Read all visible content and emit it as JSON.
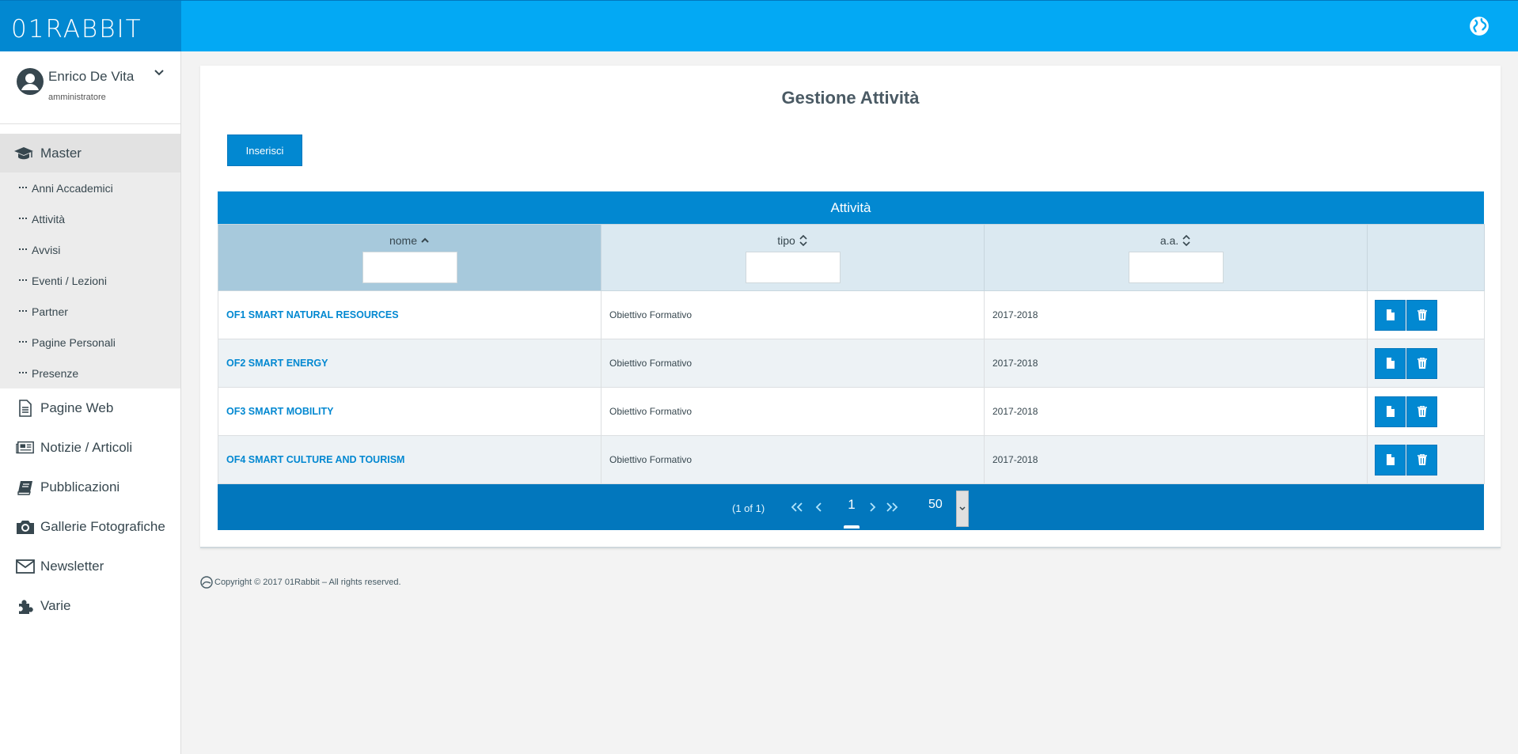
{
  "brand": {
    "logo_text": "01RABBIT"
  },
  "user": {
    "name": "Enrico De Vita",
    "role": "amministratore"
  },
  "sidebar": {
    "master": {
      "label": "Master",
      "items": [
        "Anni Accademici",
        "Attività",
        "Avvisi",
        "Eventi / Lezioni",
        "Partner",
        "Pagine Personali",
        "Presenze"
      ]
    },
    "items": [
      {
        "label": "Pagine Web",
        "icon": "document-icon"
      },
      {
        "label": "Notizie / Articoli",
        "icon": "newspaper-icon"
      },
      {
        "label": "Pubblicazioni",
        "icon": "book-icon"
      },
      {
        "label": "Gallerie Fotografiche",
        "icon": "camera-icon"
      },
      {
        "label": "Newsletter",
        "icon": "envelope-icon"
      },
      {
        "label": "Varie",
        "icon": "puzzle-icon"
      }
    ]
  },
  "main": {
    "title": "Gestione Attività",
    "insert_label": "Inserisci",
    "table": {
      "caption": "Attività",
      "columns": [
        {
          "label": "nome",
          "sort": "asc"
        },
        {
          "label": "tipo",
          "sort": "none"
        },
        {
          "label": "a.a.",
          "sort": "none"
        }
      ],
      "rows": [
        {
          "nome": "OF1 SMART NATURAL RESOURCES",
          "tipo": "Obiettivo Formativo",
          "aa": "2017-2018"
        },
        {
          "nome": "OF2 SMART ENERGY",
          "tipo": "Obiettivo Formativo",
          "aa": "2017-2018"
        },
        {
          "nome": "OF3 SMART MOBILITY",
          "tipo": "Obiettivo Formativo",
          "aa": "2017-2018"
        },
        {
          "nome": "OF4 SMART CULTURE AND TOURISM",
          "tipo": "Obiettivo Formativo",
          "aa": "2017-2018"
        }
      ]
    },
    "paginator": {
      "report": "(1 of 1)",
      "current_page": "1",
      "rows_per_page": "50"
    }
  },
  "footer": {
    "copyright": "Copyright © 2017 01Rabbit – All rights reserved."
  },
  "colors": {
    "topbar": "#03a9f4",
    "brand_dark": "#0288d1",
    "paginator": "#0277bd",
    "link": "#0288d1"
  }
}
